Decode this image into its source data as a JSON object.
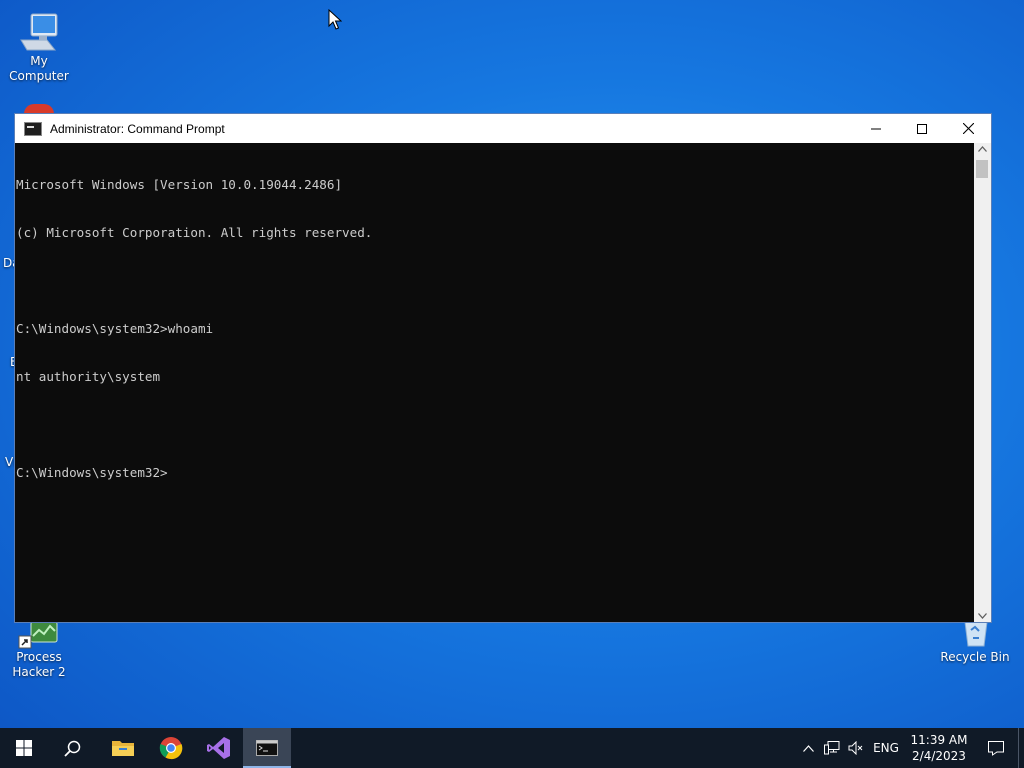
{
  "desktop": {
    "icons": {
      "my_computer": "My Computer",
      "process_hacker_line1": "Process",
      "process_hacker_line2": "Hacker 2",
      "recycle_bin": "Recycle Bin"
    },
    "partial_labels": [
      "Da",
      "E",
      "Vi"
    ]
  },
  "window": {
    "title": "Administrator:  Command Prompt",
    "console_lines": [
      "Microsoft Windows [Version 10.0.19044.2486]",
      "(c) Microsoft Corporation. All rights reserved.",
      "",
      "C:\\Windows\\system32>whoami",
      "nt authority\\system",
      "",
      "C:\\Windows\\system32>"
    ]
  },
  "taskbar": {
    "apps": [
      "start-icon",
      "search-icon",
      "file-explorer-icon",
      "chrome-icon",
      "visual-studio-icon",
      "command-prompt-icon"
    ],
    "tray": {
      "language": "ENG",
      "time": "11:39 AM",
      "date": "2/4/2023"
    }
  },
  "colors": {
    "console_bg": "#0c0c0c",
    "console_text": "#cccccc",
    "taskbar_bg": "#101a27"
  }
}
